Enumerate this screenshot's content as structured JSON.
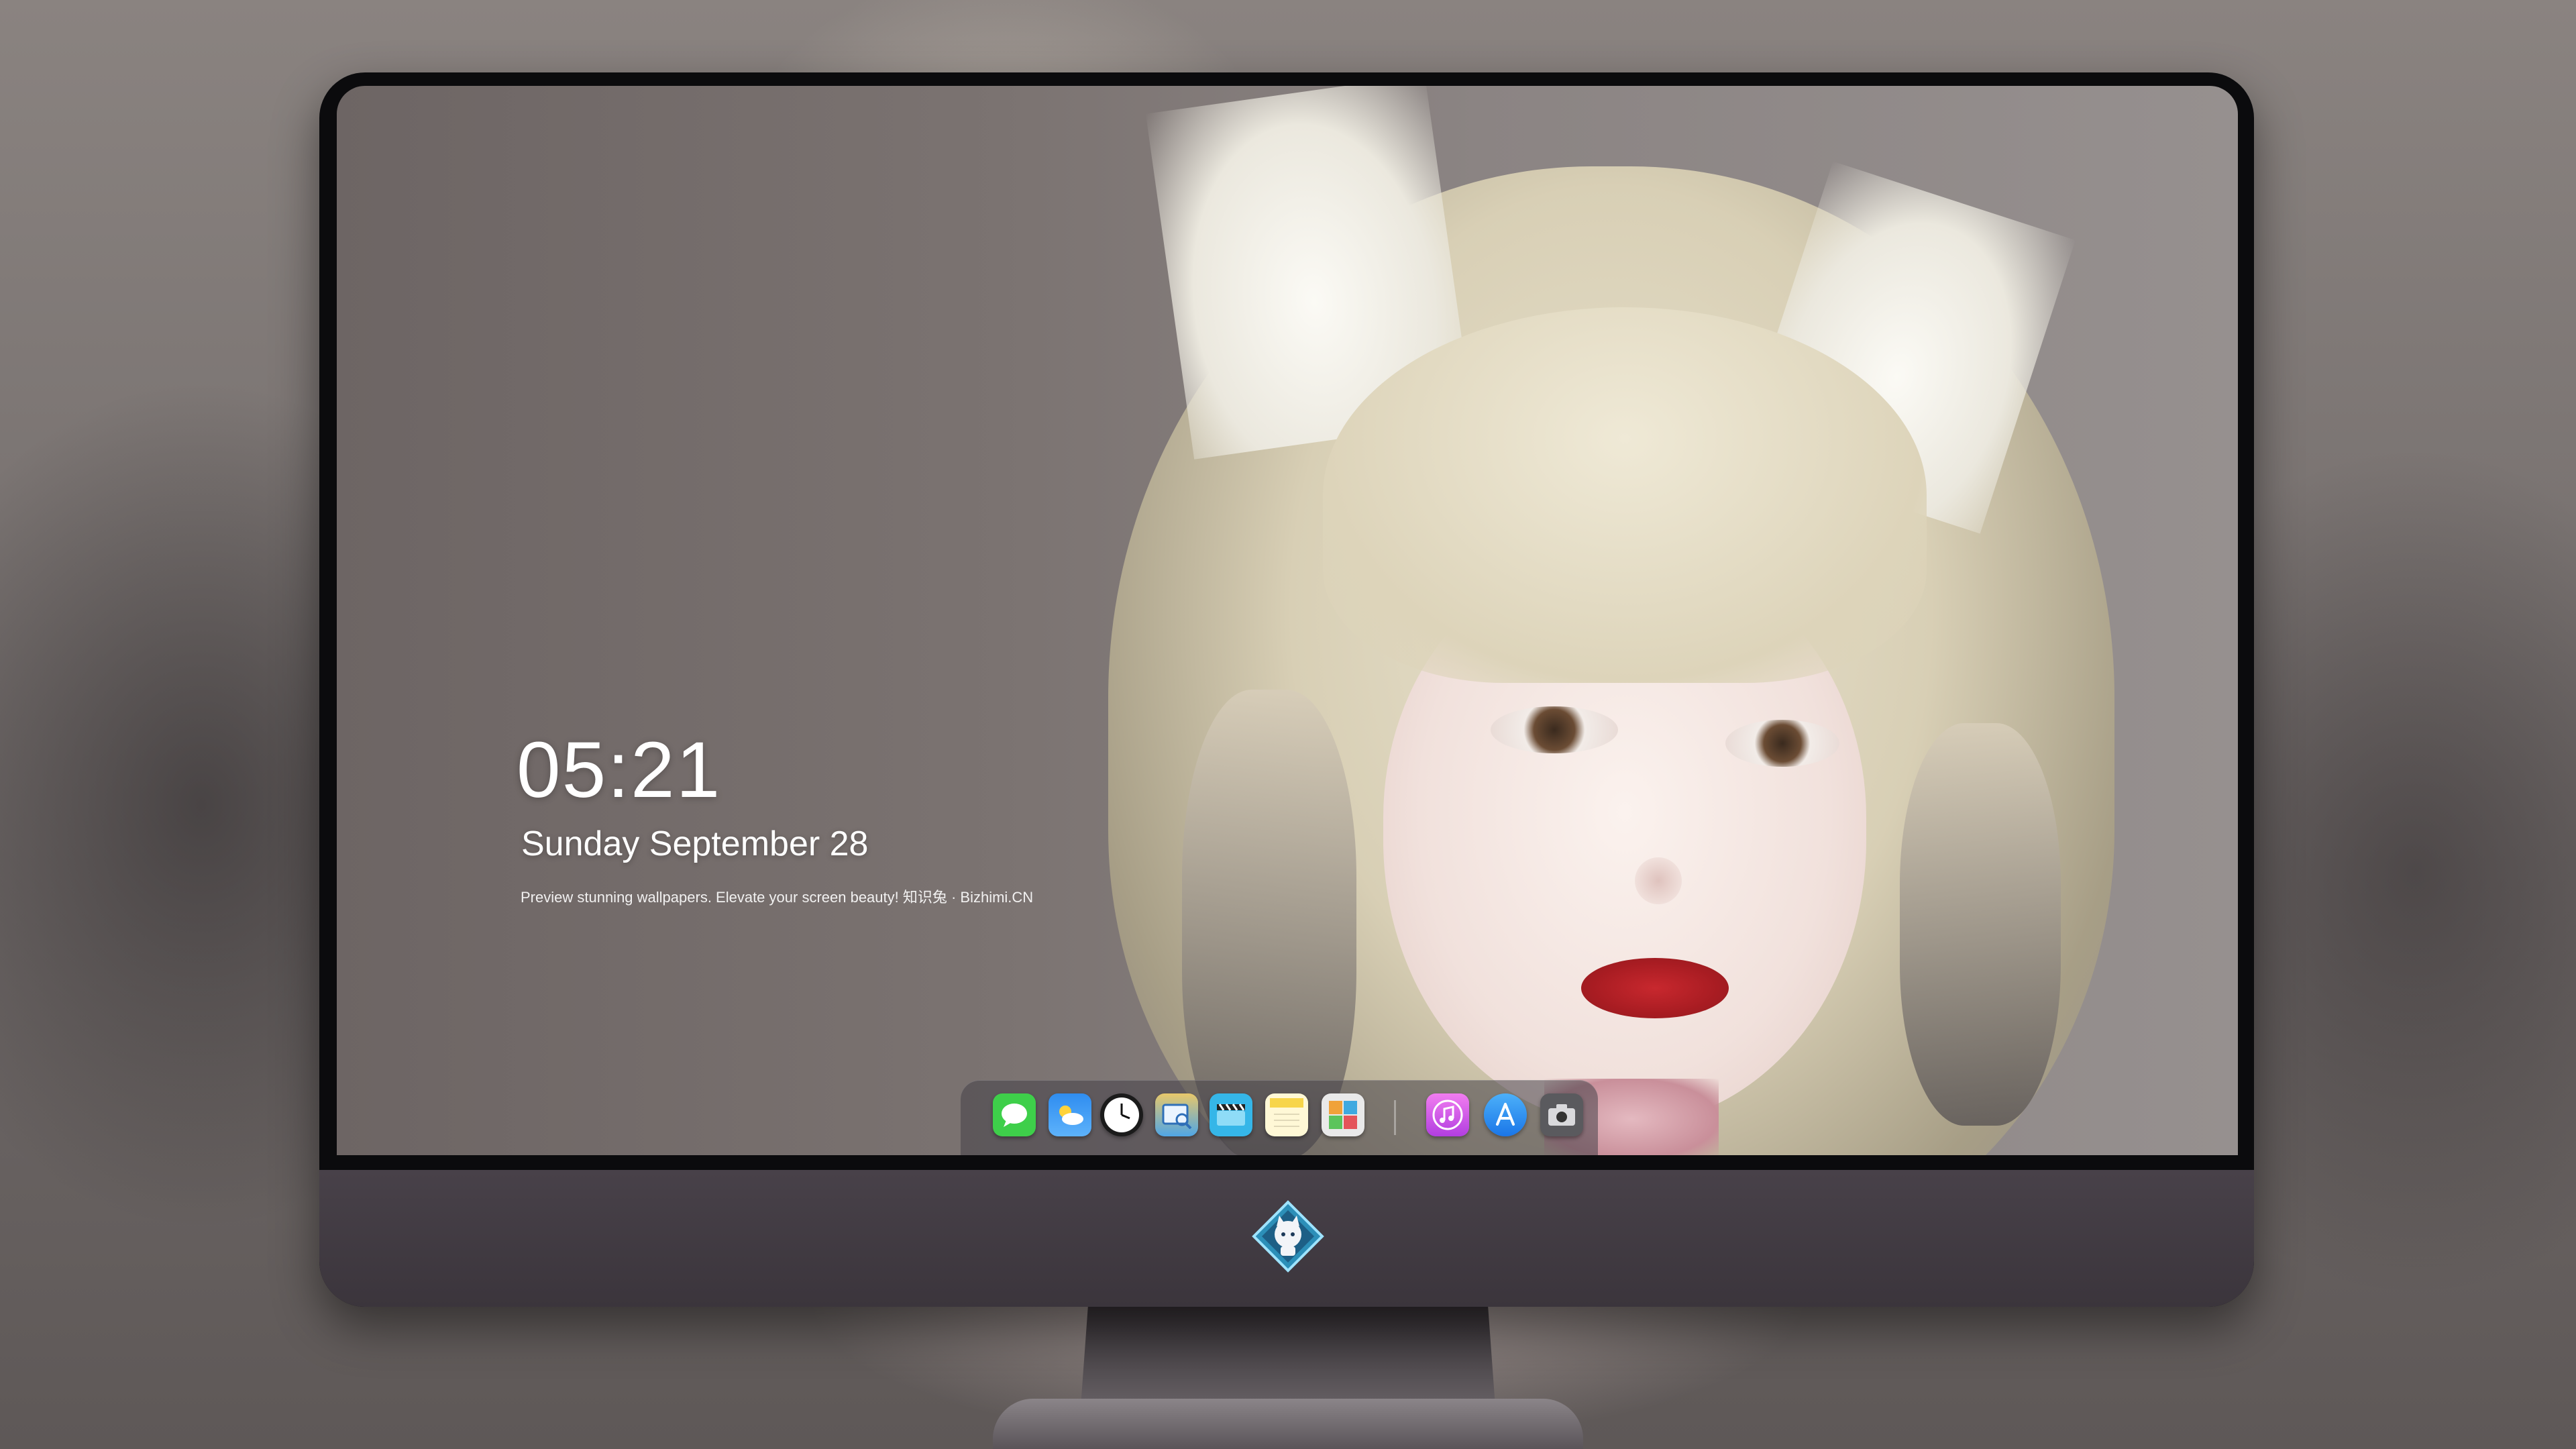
{
  "lockscreen": {
    "time": "05:21",
    "date": "Sunday September  28",
    "caption": "Preview stunning wallpapers. Elevate your screen beauty! 知识兔 · Bizhimi.CN"
  },
  "dock": {
    "apps": [
      {
        "name": "Messages",
        "icon": "messages-icon",
        "color": "#3ecf4a"
      },
      {
        "name": "Weather",
        "icon": "weather-icon",
        "color": "#2f8df0"
      },
      {
        "name": "Clock",
        "icon": "clock-icon",
        "color": "#1b1b1b"
      },
      {
        "name": "Preview",
        "icon": "preview-icon",
        "color": "#4fa6e6"
      },
      {
        "name": "Clips",
        "icon": "clapper-icon",
        "color": "#35b6e8"
      },
      {
        "name": "Notes",
        "icon": "notes-icon",
        "color": "#f7d54a"
      },
      {
        "name": "Photo Booth",
        "icon": "photo-booth-icon",
        "color": "#e9e9e9"
      },
      {
        "name": "iTunes",
        "icon": "music-icon",
        "color": "#e44bd4"
      },
      {
        "name": "App Store",
        "icon": "app-store-icon",
        "color": "#2a8ff3"
      },
      {
        "name": "Camera",
        "icon": "camera-icon",
        "color": "#5a5a5e"
      }
    ]
  },
  "monitor": {
    "logo": "cat-mascot-logo"
  }
}
